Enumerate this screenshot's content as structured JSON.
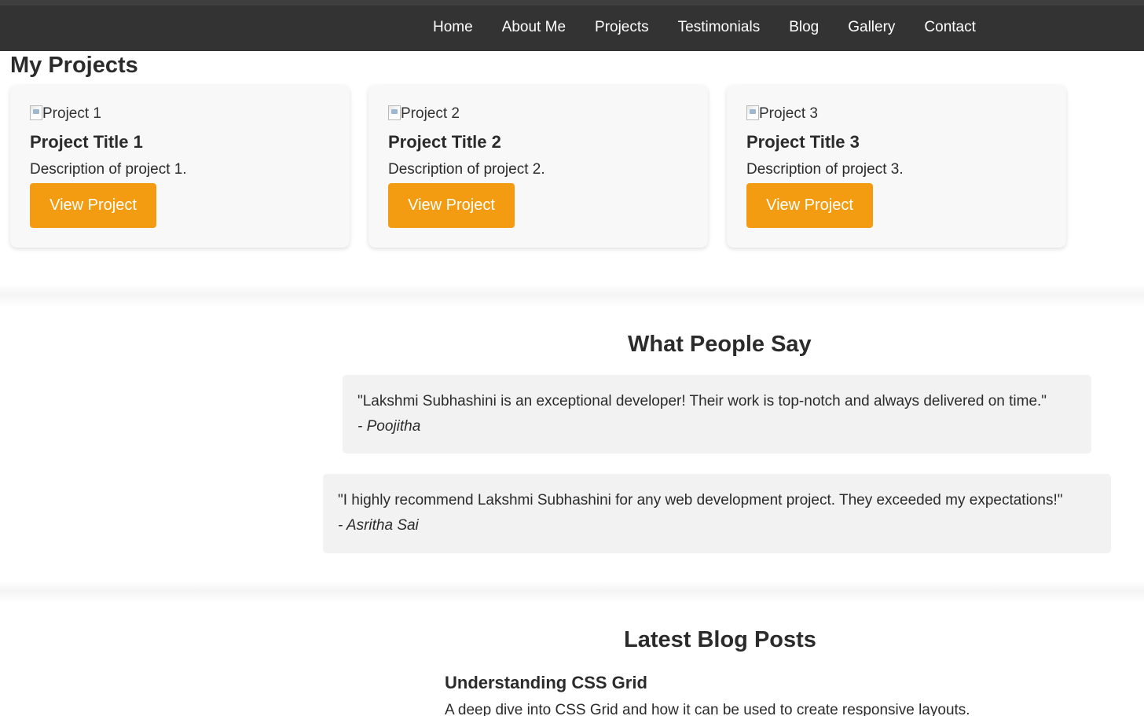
{
  "nav": {
    "items": [
      "Home",
      "About Me",
      "Projects",
      "Testimonials",
      "Blog",
      "Gallery",
      "Contact"
    ]
  },
  "projects": {
    "heading": "My Projects",
    "cards": [
      {
        "img_alt": "Project 1",
        "title": "Project Title 1",
        "description": "Description of project 1.",
        "button": "View Project"
      },
      {
        "img_alt": "Project 2",
        "title": "Project Title 2",
        "description": "Description of project 2.",
        "button": "View Project"
      },
      {
        "img_alt": "Project 3",
        "title": "Project Title 3",
        "description": "Description of project 3.",
        "button": "View Project"
      }
    ]
  },
  "testimonials": {
    "heading": "What People Say",
    "items": [
      {
        "quote": "\"Lakshmi Subhashini is an exceptional developer! Their work is top-notch and always delivered on time.\"",
        "author": "- Poojitha"
      },
      {
        "quote": "\"I highly recommend Lakshmi Subhashini for any web development project. They exceeded my expectations!\"",
        "author": "- Asritha Sai"
      }
    ]
  },
  "blog": {
    "heading": "Latest Blog Posts",
    "posts": [
      {
        "title": "Understanding CSS Grid",
        "excerpt": "A deep dive into CSS Grid and how it can be used to create responsive layouts."
      }
    ]
  },
  "colors": {
    "nav_bg": "#333333",
    "accent": "#f39c12",
    "card_bg": "#f8f8f8",
    "testimonial_bg": "#f2f2f2"
  }
}
